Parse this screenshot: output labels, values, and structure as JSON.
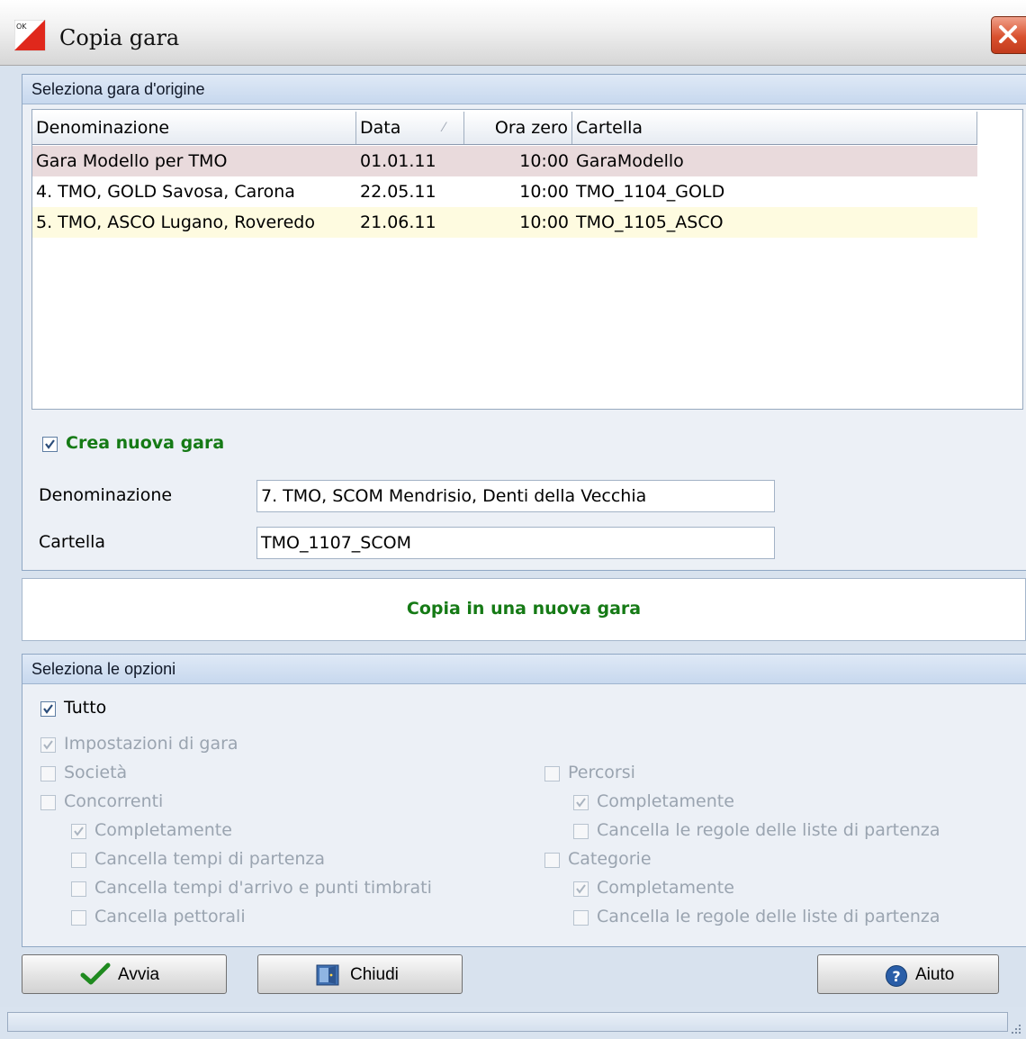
{
  "window": {
    "title": "Copia gara",
    "logo_text": "OK"
  },
  "source_group": {
    "header": "Seleziona gara d'origine",
    "columns": [
      "Denominazione",
      "Data",
      "Ora zero",
      "Cartella"
    ],
    "rows": [
      {
        "name": "Gara Modello per TMO",
        "date": "01.01.11",
        "time": "10:00",
        "folder": "GaraModello",
        "state": "selected"
      },
      {
        "name": "4. TMO, GOLD Savosa, Carona",
        "date": "22.05.11",
        "time": "10:00",
        "folder": "TMO_1104_GOLD",
        "state": "normal"
      },
      {
        "name": "5. TMO, ASCO Lugano, Roveredo",
        "date": "21.06.11",
        "time": "10:00",
        "folder": "TMO_1105_ASCO",
        "state": "highlighted"
      }
    ],
    "create_new": {
      "label": "Crea nuova gara",
      "checked": true
    },
    "name_field": {
      "label": "Denominazione",
      "value": "7. TMO, SCOM Mendrisio, Denti della Vecchia"
    },
    "folder_field": {
      "label": "Cartella",
      "value": "TMO_1107_SCOM"
    }
  },
  "banner": {
    "text": "Copia in una nuova gara"
  },
  "options_group": {
    "header": "Seleziona le opzioni",
    "tutto": {
      "label": "Tutto",
      "checked": true
    },
    "impostazioni": {
      "label": "Impostazioni di gara",
      "checked": true
    },
    "societa": {
      "label": "Società",
      "checked": false
    },
    "concorrenti": {
      "label": "Concorrenti",
      "checked": false
    },
    "conc_completamente": {
      "label": "Completamente",
      "checked": true
    },
    "conc_tempi_partenza": {
      "label": "Cancella tempi di partenza",
      "checked": false
    },
    "conc_tempi_arrivo": {
      "label": "Cancella tempi d'arrivo e punti timbrati",
      "checked": false
    },
    "conc_pettorali": {
      "label": "Cancella pettorali",
      "checked": false
    },
    "percorsi": {
      "label": "Percorsi",
      "checked": false
    },
    "perc_completamente": {
      "label": "Completamente",
      "checked": true
    },
    "perc_regole": {
      "label": "Cancella le regole delle liste di partenza",
      "checked": false
    },
    "categorie": {
      "label": "Categorie",
      "checked": false
    },
    "cat_completamente": {
      "label": "Completamente",
      "checked": true
    },
    "cat_regole": {
      "label": "Cancella le regole delle liste di partenza",
      "checked": false
    }
  },
  "buttons": {
    "avvia": "Avvia",
    "chiudi": "Chiudi",
    "aiuto": "Aiuto"
  },
  "colors": {
    "selected_row": "#e9dadc",
    "highlight_row": "#fefbe0",
    "accent_green": "#157a15"
  }
}
